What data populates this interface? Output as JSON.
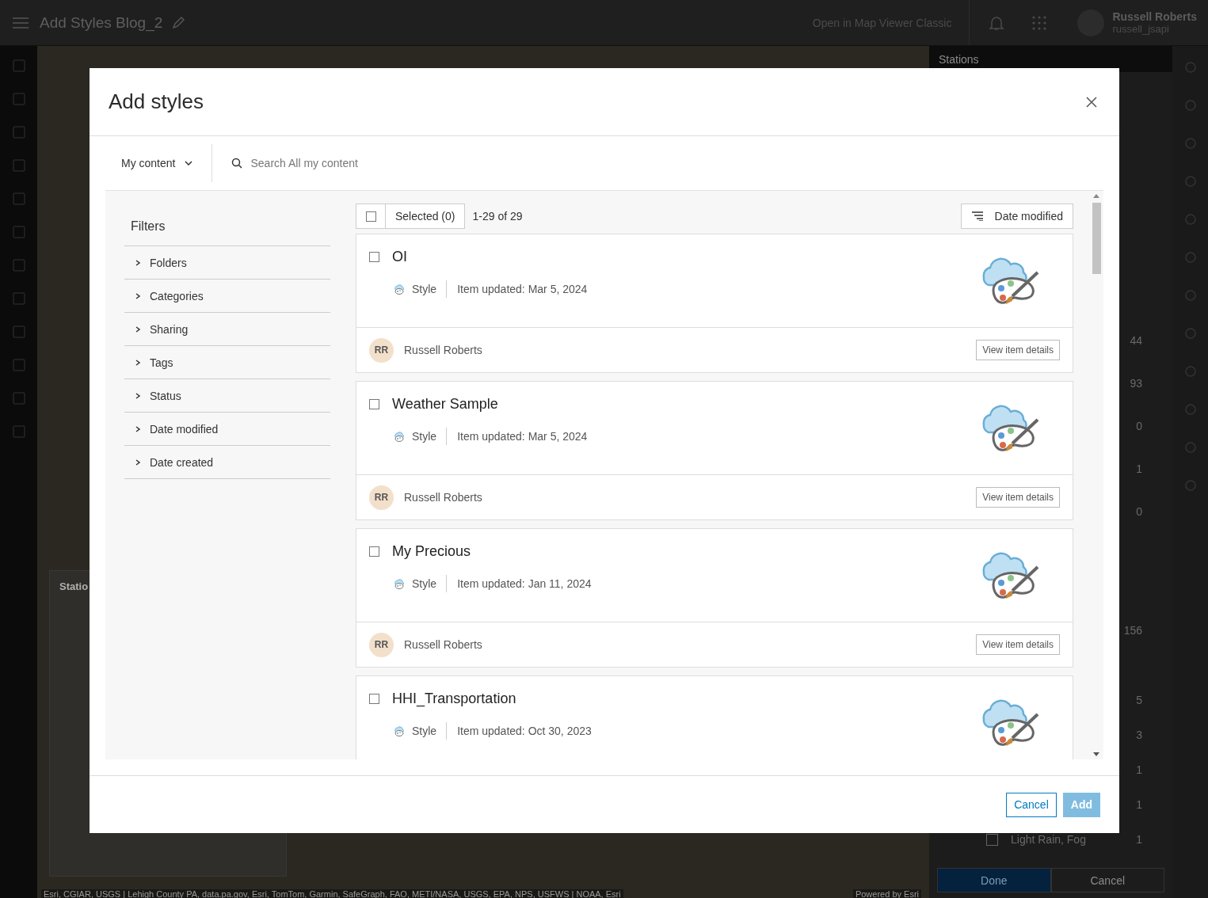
{
  "app_header": {
    "title": "Add Styles Blog_2",
    "link": "Open in Map Viewer Classic",
    "user_name": "Russell Roberts",
    "username": "russell_jsapi"
  },
  "side_panel": {
    "title": "Stations",
    "values": [
      "44",
      "93",
      "0",
      "1",
      "0",
      "156",
      "5",
      "3",
      "1",
      "1"
    ],
    "category_row": {
      "label": "Light Rain, Fog",
      "value": "1",
      "checked": false
    },
    "buttons": [
      "Done",
      "Cancel"
    ]
  },
  "legend_panel": {
    "title": "Statio"
  },
  "attribution": "Esri, CGIAR, USGS | Lehigh County PA, data.pa.gov, Esri, TomTom, Garmin, SafeGraph, FAO, METI/NASA, USGS, EPA, NPS, USFWS | NOAA, Esri",
  "powered_by": "Powered by Esri",
  "dialog": {
    "title": "Add styles",
    "source": "My content",
    "search": {
      "placeholder": "Search All my content"
    },
    "filters": {
      "title": "Filters",
      "items": [
        {
          "label": "Folders",
          "expanded": false
        },
        {
          "label": "Categories",
          "expanded": false
        },
        {
          "label": "Sharing",
          "expanded": false
        },
        {
          "label": "Tags",
          "expanded": false
        },
        {
          "label": "Status",
          "expanded": false
        },
        {
          "label": "Date modified",
          "expanded": false
        },
        {
          "label": "Date created",
          "expanded": false
        }
      ]
    },
    "toolbar": {
      "select_all_checked": false,
      "selected_label": "Selected (0)",
      "count": "1-29 of 29",
      "sort": "Date modified"
    },
    "items": [
      {
        "title": "OI",
        "checked": false,
        "type": "Style",
        "updated": "Item updated: Mar 5, 2024",
        "owner_initials": "RR",
        "owner": "Russell Roberts",
        "details": "View item details"
      },
      {
        "title": "Weather Sample",
        "checked": false,
        "type": "Style",
        "updated": "Item updated: Mar 5, 2024",
        "owner_initials": "RR",
        "owner": "Russell Roberts",
        "details": "View item details"
      },
      {
        "title": "My Precious",
        "checked": false,
        "type": "Style",
        "updated": "Item updated: Jan 11, 2024",
        "owner_initials": "RR",
        "owner": "Russell Roberts",
        "details": "View item details"
      },
      {
        "title": "HHI_Transportation",
        "checked": false,
        "type": "Style",
        "updated": "Item updated: Oct 30, 2023"
      }
    ],
    "buttons": {
      "cancel": "Cancel",
      "add": {
        "label": "Add",
        "disabled": true
      }
    }
  }
}
